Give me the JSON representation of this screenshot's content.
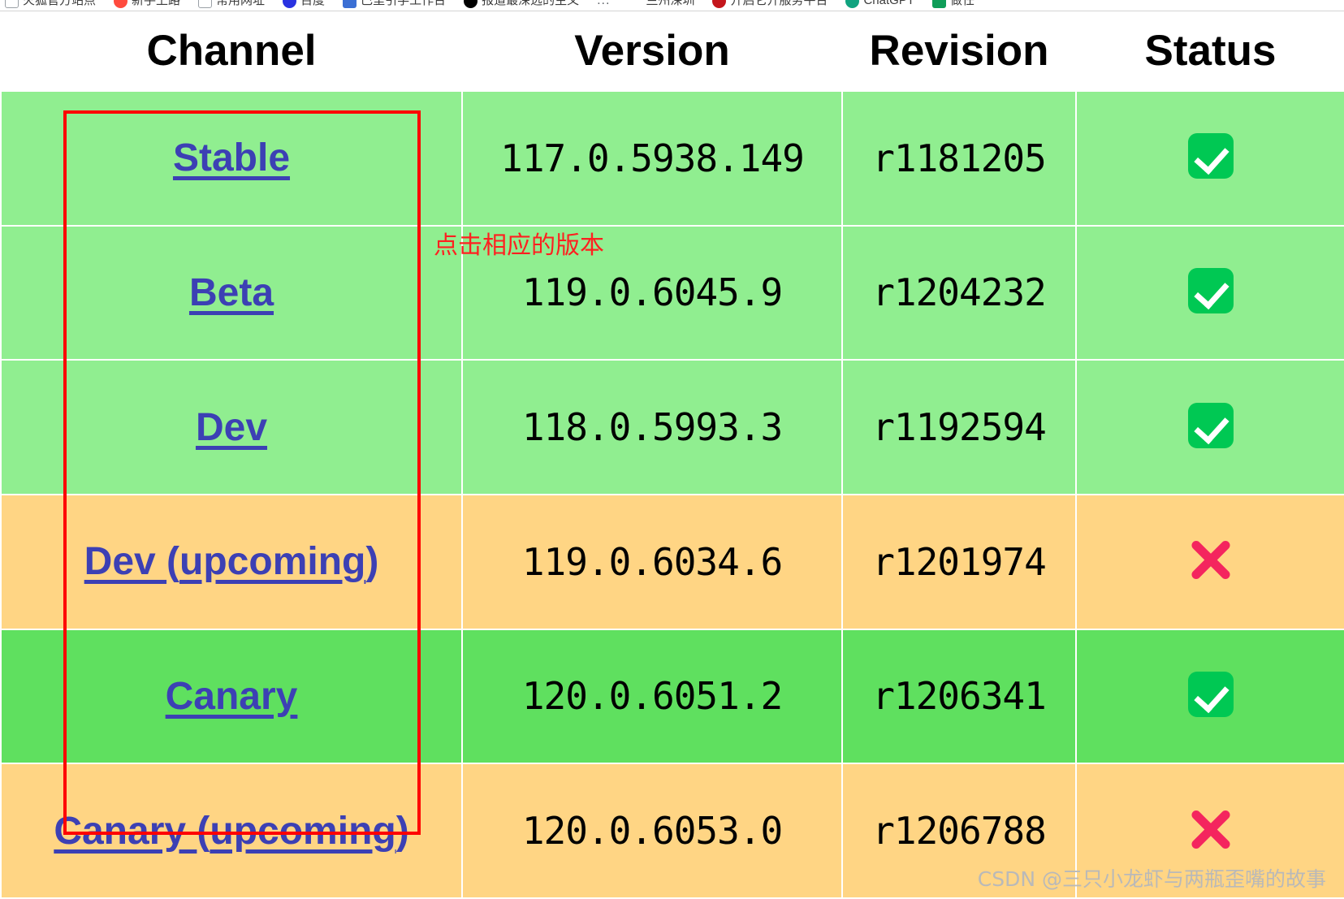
{
  "browser": {
    "bookmarks_bar": {
      "overflow_label": "...",
      "items": [
        {
          "label": "火狐官方站点",
          "icon": "bookmark-outline-icon",
          "color": "#ffffff"
        },
        {
          "label": "新手上路",
          "icon": "firefox-icon",
          "color": "#ff4b3e"
        },
        {
          "label": "常用网址",
          "icon": "bookmark-outline-icon",
          "color": "#ffffff"
        },
        {
          "label": "百度",
          "icon": "baidu-icon",
          "color": "#2932e1"
        },
        {
          "label": "巴里引学工作台",
          "icon": "blue-folder-icon",
          "color": "#3b6fd4"
        },
        {
          "label": "报道最深远的主义",
          "icon": "tiktok-icon",
          "color": "#000000"
        },
        {
          "label": "兰州深圳",
          "icon": "shield-icon",
          "color": "#ffffff"
        },
        {
          "label": "开启它开服务平台",
          "icon": "red-dot-icon",
          "color": "#c4161c"
        },
        {
          "label": "ChatGPT",
          "icon": "chatgpt-icon",
          "color": "#10a37f"
        },
        {
          "label": "做任",
          "icon": "green-square-icon",
          "color": "#0f9d58"
        }
      ]
    }
  },
  "table": {
    "headers": [
      "Channel",
      "Version",
      "Revision",
      "Status"
    ],
    "rows": [
      {
        "channel": "Stable",
        "channel_prefix": "",
        "channel_suffix": "",
        "version": "117.0.5938.149",
        "revision": "r1181205",
        "status": "ok",
        "row_style": "row-green"
      },
      {
        "channel": "Beta",
        "channel_prefix": "",
        "channel_suffix": "",
        "version": "119.0.6045.9",
        "revision": "r1204232",
        "status": "ok",
        "row_style": "row-green"
      },
      {
        "channel": "Dev",
        "channel_prefix": "",
        "channel_suffix": "",
        "version": "118.0.5993.3",
        "revision": "r1192594",
        "status": "ok",
        "row_style": "row-green"
      },
      {
        "channel": "Dev (upcoming)",
        "channel_prefix": "Dev ",
        "channel_suffix": "(upcoming)",
        "version": "119.0.6034.6",
        "revision": "r1201974",
        "status": "bad",
        "row_style": "row-orange"
      },
      {
        "channel": "Canary",
        "channel_prefix": "",
        "channel_suffix": "",
        "version": "120.0.6051.2",
        "revision": "r1206341",
        "status": "ok",
        "row_style": "row-brightgreen"
      },
      {
        "channel": "Canary (upcoming)",
        "channel_prefix": "Canary ",
        "channel_suffix": "(upcoming)",
        "version": "120.0.6053.0",
        "revision": "r1206788",
        "status": "bad",
        "row_style": "row-orange"
      }
    ]
  },
  "annotations": {
    "note_text": "点击相应的版本",
    "note_color": "#ff2020",
    "box_color": "#ff0000"
  },
  "watermark": {
    "text": "CSDN @三只小龙虾与两瓶歪嘴的故事"
  },
  "colors": {
    "row_green": "#90ee90",
    "row_orange": "#ffd584",
    "row_bright_green": "#5fe05f",
    "link_blue": "#3c40b4",
    "status_ok": "#00c853",
    "status_bad": "#f4255e"
  }
}
